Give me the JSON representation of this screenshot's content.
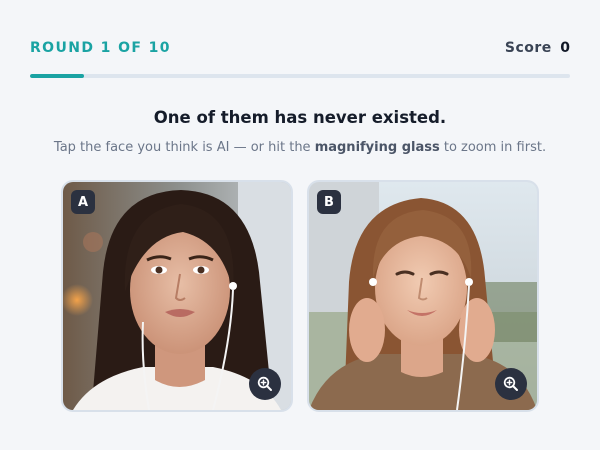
{
  "header": {
    "round_label": "ROUND 1 OF 10",
    "score_label": "Score",
    "score_value": "0"
  },
  "progress": {
    "fraction": 0.1,
    "color": "#1aa3a3"
  },
  "prompt": {
    "headline": "One of them has never existed.",
    "sub_before": "Tap the face you think is AI — or hit the ",
    "sub_bold": "magnifying glass",
    "sub_after": " to zoom in first."
  },
  "cards": [
    {
      "badge": "A",
      "zoom_icon": "zoom-in-icon"
    },
    {
      "badge": "B",
      "zoom_icon": "zoom-in-icon"
    }
  ]
}
